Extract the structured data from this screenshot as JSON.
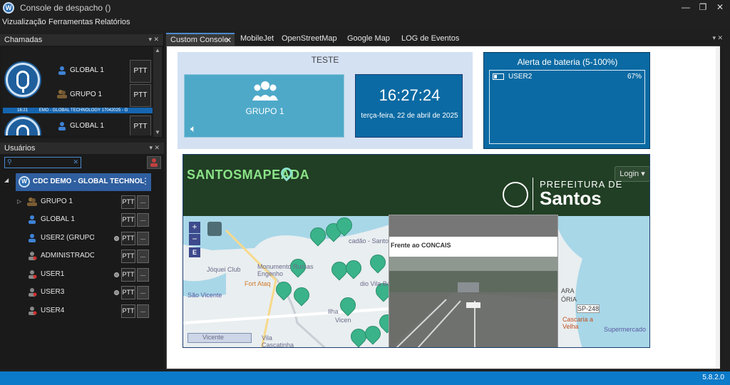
{
  "window": {
    "title": "Console de despacho ()",
    "app_icon": "W"
  },
  "menu": [
    {
      "label": "Vizualização",
      "key": "V"
    },
    {
      "label": "Ferramentas",
      "key": "F"
    },
    {
      "label": "Relatórios",
      "key": "R"
    }
  ],
  "calls_panel": {
    "title": "Chamadas",
    "call_rows": [
      {
        "user": "GLOBAL 1",
        "group": "GRUPO 1",
        "ptt": "PTT"
      },
      {
        "user": "GLOBAL 1",
        "ptt": "PTT"
      }
    ],
    "ticker_time": "16:21",
    "ticker_text": "EMO - GLOBAL TECHNOLOGY 17042025 - G"
  },
  "users_panel": {
    "title": "Usuários",
    "search_placeholder": "",
    "root": "CDC DEMO - GLOBAL TECHNOL",
    "items": [
      {
        "label": "GRUPO 1",
        "type": "group",
        "ptt": "PTT",
        "more": "..."
      },
      {
        "label": "GLOBAL 1",
        "type": "user-online",
        "ptt": "PTT",
        "more": "..."
      },
      {
        "label": "USER2 (GRUPO 1",
        "type": "user-online",
        "ptt": "PTT",
        "more": "..."
      },
      {
        "label": "ADMINISTRADOR",
        "type": "user-offline",
        "ptt": "PTT",
        "more": "..."
      },
      {
        "label": "USER1",
        "type": "user-offline",
        "ptt": "PTT",
        "more": "..."
      },
      {
        "label": "USER3",
        "type": "user-offline",
        "ptt": "PTT",
        "more": "..."
      },
      {
        "label": "USER4",
        "type": "user-offline",
        "ptt": "PTT",
        "more": "..."
      }
    ]
  },
  "tabs": [
    {
      "label": "Custom Console",
      "active": true
    },
    {
      "label": "MobileJet"
    },
    {
      "label": "OpenStreetMap"
    },
    {
      "label": "Google Map"
    },
    {
      "label": "LOG de Eventos"
    }
  ],
  "group_widget": {
    "title": "TESTE",
    "group_name": "GRUPO 1",
    "time": "16:27:24",
    "date": "terça-feira, 22 de abril de 2025"
  },
  "battery_widget": {
    "title": "Alerta de bateria (5-100%)",
    "user": "USER2",
    "percent": "67%"
  },
  "map": {
    "logo": "SANTOSMAPEADA",
    "login": "Login",
    "pref_small": "PREFEITURA DE",
    "pref_big": "Santos",
    "popup_title": "Frente ao CONCAIS",
    "labels": [
      "Jóquei Club",
      "Monumento Ruínas Engenho",
      "Fort Ataq",
      "São Vicente",
      "Ilha",
      "Vicen",
      "Vila Cascatinha",
      "cadão - Santos",
      "dio Vila Be",
      "SP-248",
      "Cascaria a Velha",
      "Supermercado",
      "ARA",
      "ÓRIA",
      "Vicente"
    ]
  },
  "status": {
    "version": "5.8.2.0"
  },
  "colors": {
    "accent": "#0b7ac8",
    "tile": "#4ea9c9",
    "clock": "#0b6aa3",
    "map_header": "#213f24"
  }
}
